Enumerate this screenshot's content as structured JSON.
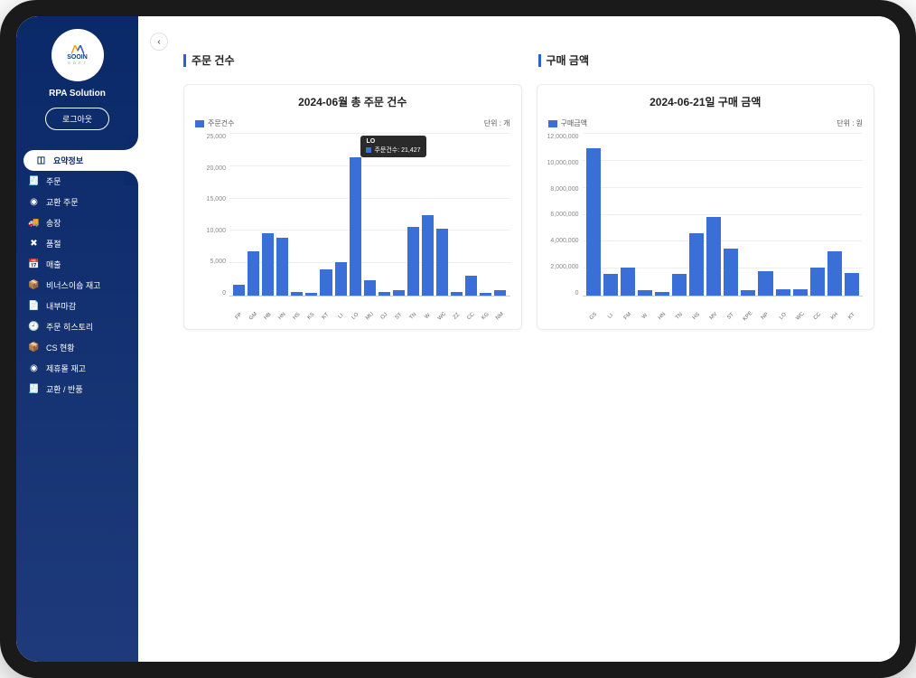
{
  "brand": "RPA Solution",
  "logo": {
    "name": "SOOIN",
    "sub": "S O F T"
  },
  "logout_label": "로그아웃",
  "nav": [
    {
      "key": "summary",
      "label": "요약정보",
      "icon": "◫",
      "active": true
    },
    {
      "key": "order",
      "label": "주문",
      "icon": "🧾"
    },
    {
      "key": "exchange_order",
      "label": "교환 주문",
      "icon": "◉"
    },
    {
      "key": "shipping",
      "label": "송장",
      "icon": "🚚"
    },
    {
      "key": "soldout",
      "label": "품절",
      "icon": "✖"
    },
    {
      "key": "sales",
      "label": "매출",
      "icon": "📅"
    },
    {
      "key": "venus_stock",
      "label": "비너스이숌 재고",
      "icon": "📦"
    },
    {
      "key": "internal_close",
      "label": "내부마감",
      "icon": "📄"
    },
    {
      "key": "order_history",
      "label": "주문 히스토리",
      "icon": "🕘"
    },
    {
      "key": "cs_status",
      "label": "CS 현황",
      "icon": "📦"
    },
    {
      "key": "affiliate_stock",
      "label": "제휴몰 재고",
      "icon": "◉"
    },
    {
      "key": "exchange_return",
      "label": "교환 / 반품",
      "icon": "🧾"
    }
  ],
  "sections": {
    "left_header": "주문 건수",
    "right_header": "구매 금액"
  },
  "chart_data": [
    {
      "type": "bar",
      "title": "2024-06월 총 주문 건수",
      "legend": "주문건수",
      "unit_label": "단위 : 개",
      "ylim": [
        0,
        25000
      ],
      "yticks": [
        0,
        5000,
        10000,
        15000,
        20000,
        25000
      ],
      "categories": [
        "FP",
        "GM",
        "HB",
        "HN",
        "HS",
        "KS",
        "KT",
        "LI",
        "LO",
        "MU",
        "OJ",
        "ST",
        "TN",
        "W",
        "WC",
        "ZZ",
        "CC",
        "KG",
        "NM"
      ],
      "values": [
        1700,
        6800,
        9700,
        9000,
        600,
        400,
        4000,
        5100,
        21427,
        2400,
        600,
        800,
        10600,
        12400,
        10400,
        600,
        3100,
        400,
        800
      ],
      "tooltip": {
        "category": "LO",
        "series": "주문건수",
        "value": 21427,
        "bar_index": 8
      }
    },
    {
      "type": "bar",
      "title": "2024-06-21일 구매 금액",
      "legend": "구매금액",
      "unit_label": "단위 : 원",
      "ylim": [
        0,
        12000000
      ],
      "yticks": [
        0,
        2000000,
        4000000,
        6000000,
        8000000,
        10000000,
        12000000
      ],
      "categories": [
        "GS",
        "LI",
        "FM",
        "W",
        "HN",
        "TN",
        "HS",
        "MV",
        "ST",
        "KPE",
        "NP",
        "LO",
        "WC",
        "CC",
        "KH",
        "KT"
      ],
      "values": [
        10900000,
        1600000,
        2100000,
        400000,
        300000,
        1600000,
        4600000,
        5800000,
        3500000,
        400000,
        1800000,
        500000,
        500000,
        2100000,
        3300000,
        1700000
      ]
    }
  ]
}
